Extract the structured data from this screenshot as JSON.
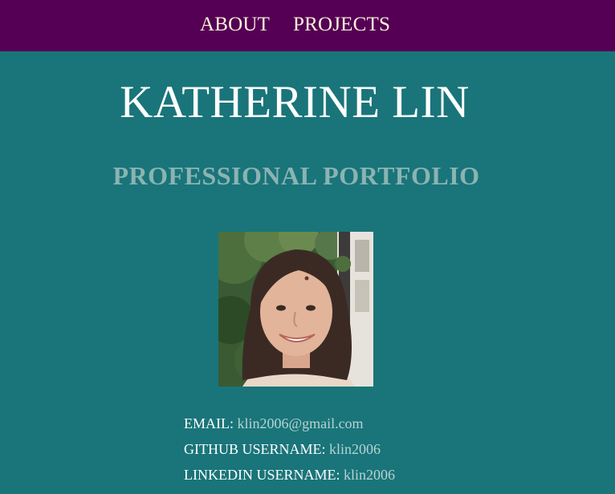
{
  "nav": {
    "about_label": "ABOUT",
    "projects_label": "PROJECTS"
  },
  "header": {
    "name": "KATHERINE LIN",
    "subtitle": "PROFESSIONAL PORTFOLIO"
  },
  "contact": {
    "email_label": "EMAIL:",
    "email_value": "klin2006@gmail.com",
    "github_label": "GITHUB USERNAME:",
    "github_value": "klin2006",
    "linkedin_label": "LINKEDIN USERNAME:",
    "linkedin_value": "klin2006"
  },
  "colors": {
    "nav_background": "#550055",
    "page_background": "#19757a",
    "subtitle": "#8cb3b2",
    "nav_text": "#fff3da"
  }
}
